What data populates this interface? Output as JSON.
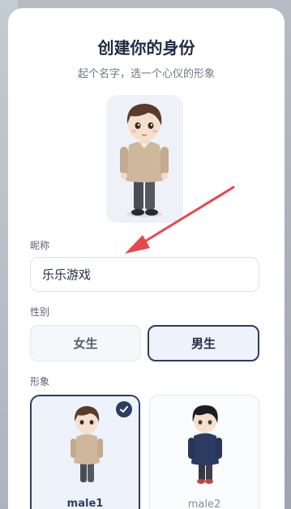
{
  "header": {
    "title": "创建你的身份",
    "subtitle": "起个名字，选一个心仪的形象"
  },
  "form": {
    "nickname_label": "昵称",
    "nickname_value": "乐乐游戏",
    "gender_label": "性别",
    "gender_options": [
      "女生",
      "男生"
    ],
    "gender_selected": "男生",
    "avatar_label": "形象",
    "avatars": [
      {
        "label": "male1",
        "selected": true
      },
      {
        "label": "male2",
        "selected": false
      }
    ]
  },
  "colors": {
    "primary": "#2e3d5f",
    "annotation_arrow": "#e8474b"
  }
}
